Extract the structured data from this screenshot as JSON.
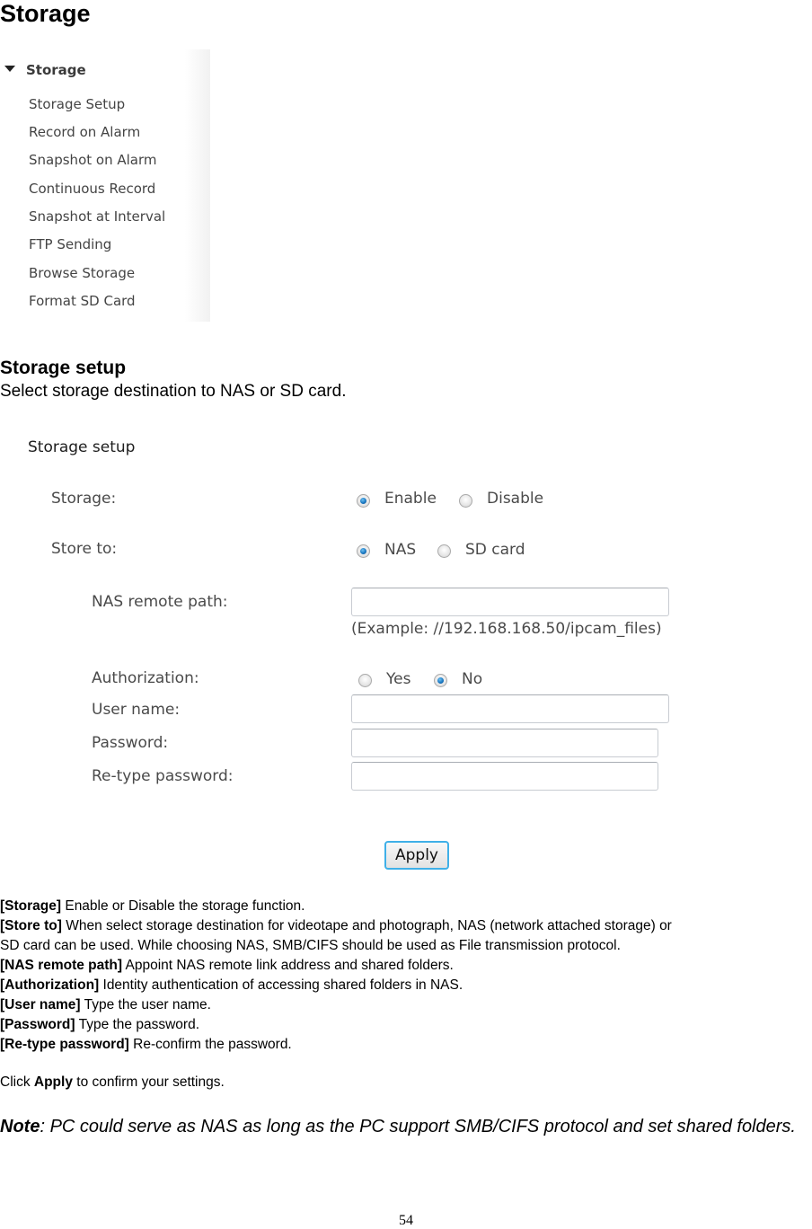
{
  "page_title": "Storage",
  "sidebar": {
    "header": "Storage",
    "items": [
      {
        "label": "Storage Setup"
      },
      {
        "label": "Record on Alarm"
      },
      {
        "label": "Snapshot on Alarm"
      },
      {
        "label": "Continuous Record"
      },
      {
        "label": "Snapshot at Interval"
      },
      {
        "label": "FTP Sending"
      },
      {
        "label": "Browse Storage"
      },
      {
        "label": "Format SD Card"
      }
    ]
  },
  "section": {
    "title": "Storage setup",
    "intro": "Select storage destination to NAS or SD card."
  },
  "form": {
    "title": "Storage setup",
    "storage": {
      "label": "Storage:",
      "options": [
        "Enable",
        "Disable"
      ],
      "selected": "Enable"
    },
    "store_to": {
      "label": "Store to:",
      "options": [
        "NAS",
        "SD card"
      ],
      "selected": "NAS"
    },
    "nas_remote_path": {
      "label": "NAS remote path:",
      "value": "",
      "example": "(Example: //192.168.168.50/ipcam_files)"
    },
    "authorization": {
      "label": "Authorization:",
      "options": [
        "Yes",
        "No"
      ],
      "selected": "No"
    },
    "user_name": {
      "label": "User name:",
      "value": ""
    },
    "password": {
      "label": "Password:",
      "value": ""
    },
    "retype_password": {
      "label": "Re-type password:",
      "value": ""
    },
    "apply_label": "Apply"
  },
  "descriptions": [
    {
      "term": "[Storage]",
      "text": " Enable or Disable the storage function."
    },
    {
      "term": "[Store to]",
      "text": " When select storage destination for videotape and photograph, NAS (network attached storage) or"
    },
    {
      "term": "",
      "text": "SD card can be used. While choosing NAS, SMB/CIFS should be used as File transmission protocol."
    },
    {
      "term": "[NAS remote path]",
      "text": " Appoint NAS remote link address and shared folders."
    },
    {
      "term": "[Authorization]",
      "text": " Identity authentication of accessing shared folders in NAS."
    },
    {
      "term": "[User name]",
      "text": " Type the user name."
    },
    {
      "term": "[Password]",
      "text": " Type the password."
    },
    {
      "term": "[Re-type password]",
      "text": " Re-confirm the password."
    }
  ],
  "click_apply": {
    "pre": "Click ",
    "bold": "Apply",
    "post": " to confirm your settings."
  },
  "note": {
    "bold": "Note",
    "text": ": PC could serve as NAS as long as the PC support SMB/CIFS protocol and set shared folders."
  },
  "page_number": "54"
}
